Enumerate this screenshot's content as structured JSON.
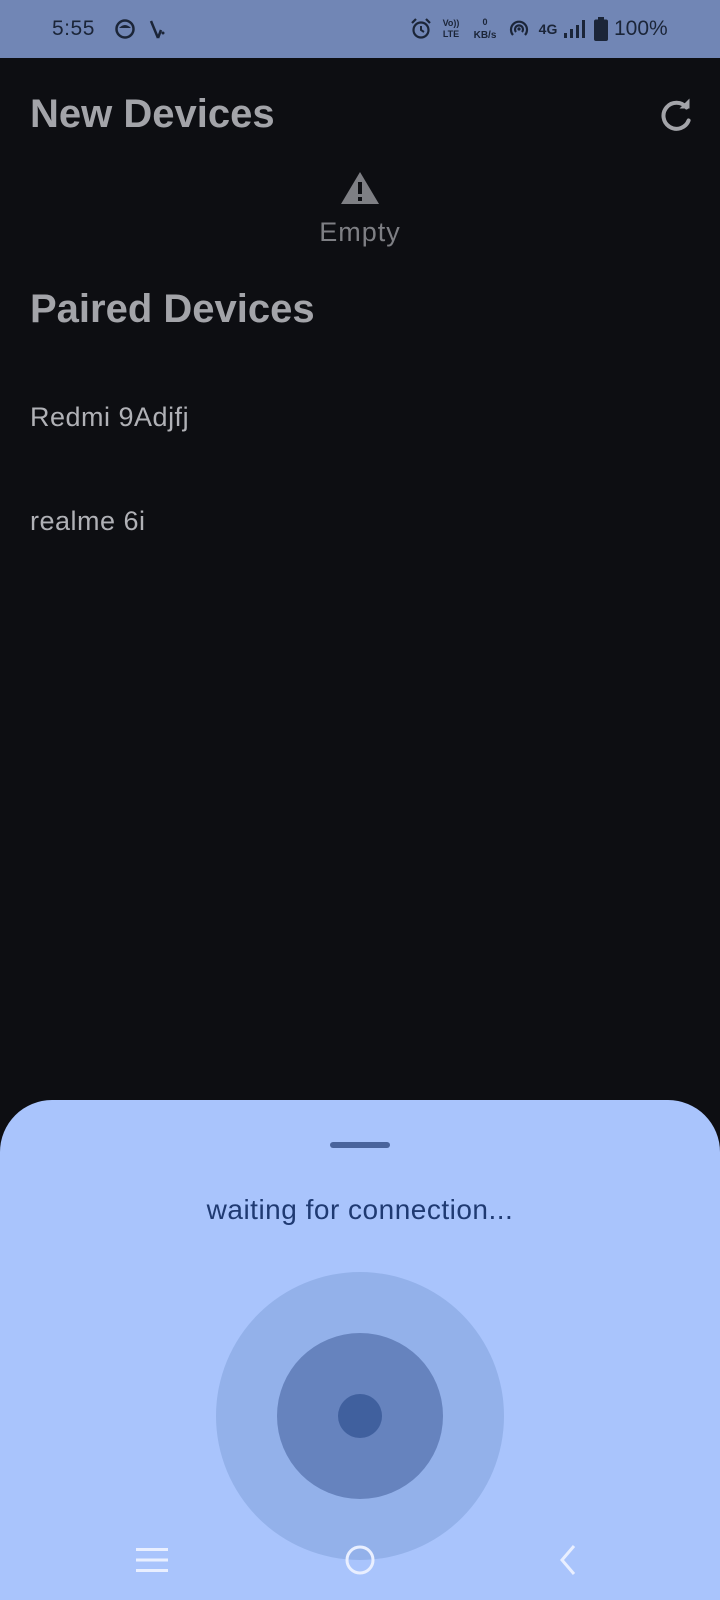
{
  "status_bar": {
    "time": "5:55",
    "volte_top": "Vo))",
    "volte_bottom": "LTE",
    "speed_value": "0",
    "speed_unit": "KB/s",
    "network": "4G",
    "battery_percent": "100%",
    "icons": [
      "status-app-icon",
      "bluetooth-icon",
      "alarm-icon",
      "hotspot-icon",
      "signal-icon",
      "battery-icon"
    ]
  },
  "new_devices": {
    "title": "New Devices",
    "refresh_icon": "refresh-icon",
    "empty_icon": "warning-icon",
    "empty_label": "Empty"
  },
  "paired_devices": {
    "title": "Paired Devices",
    "items": [
      {
        "label": "Redmi 9Adjfj"
      },
      {
        "label": "realme 6i"
      }
    ]
  },
  "bottom_sheet": {
    "status_text": "waiting for connection...",
    "colors": {
      "sheet": "#a9c4fc",
      "outer_ring": "#93b1ea",
      "middle_ring": "#6683be",
      "core": "#40609e"
    }
  },
  "nav_bar": {
    "icons": [
      "menu-icon",
      "home-icon",
      "back-icon"
    ]
  }
}
